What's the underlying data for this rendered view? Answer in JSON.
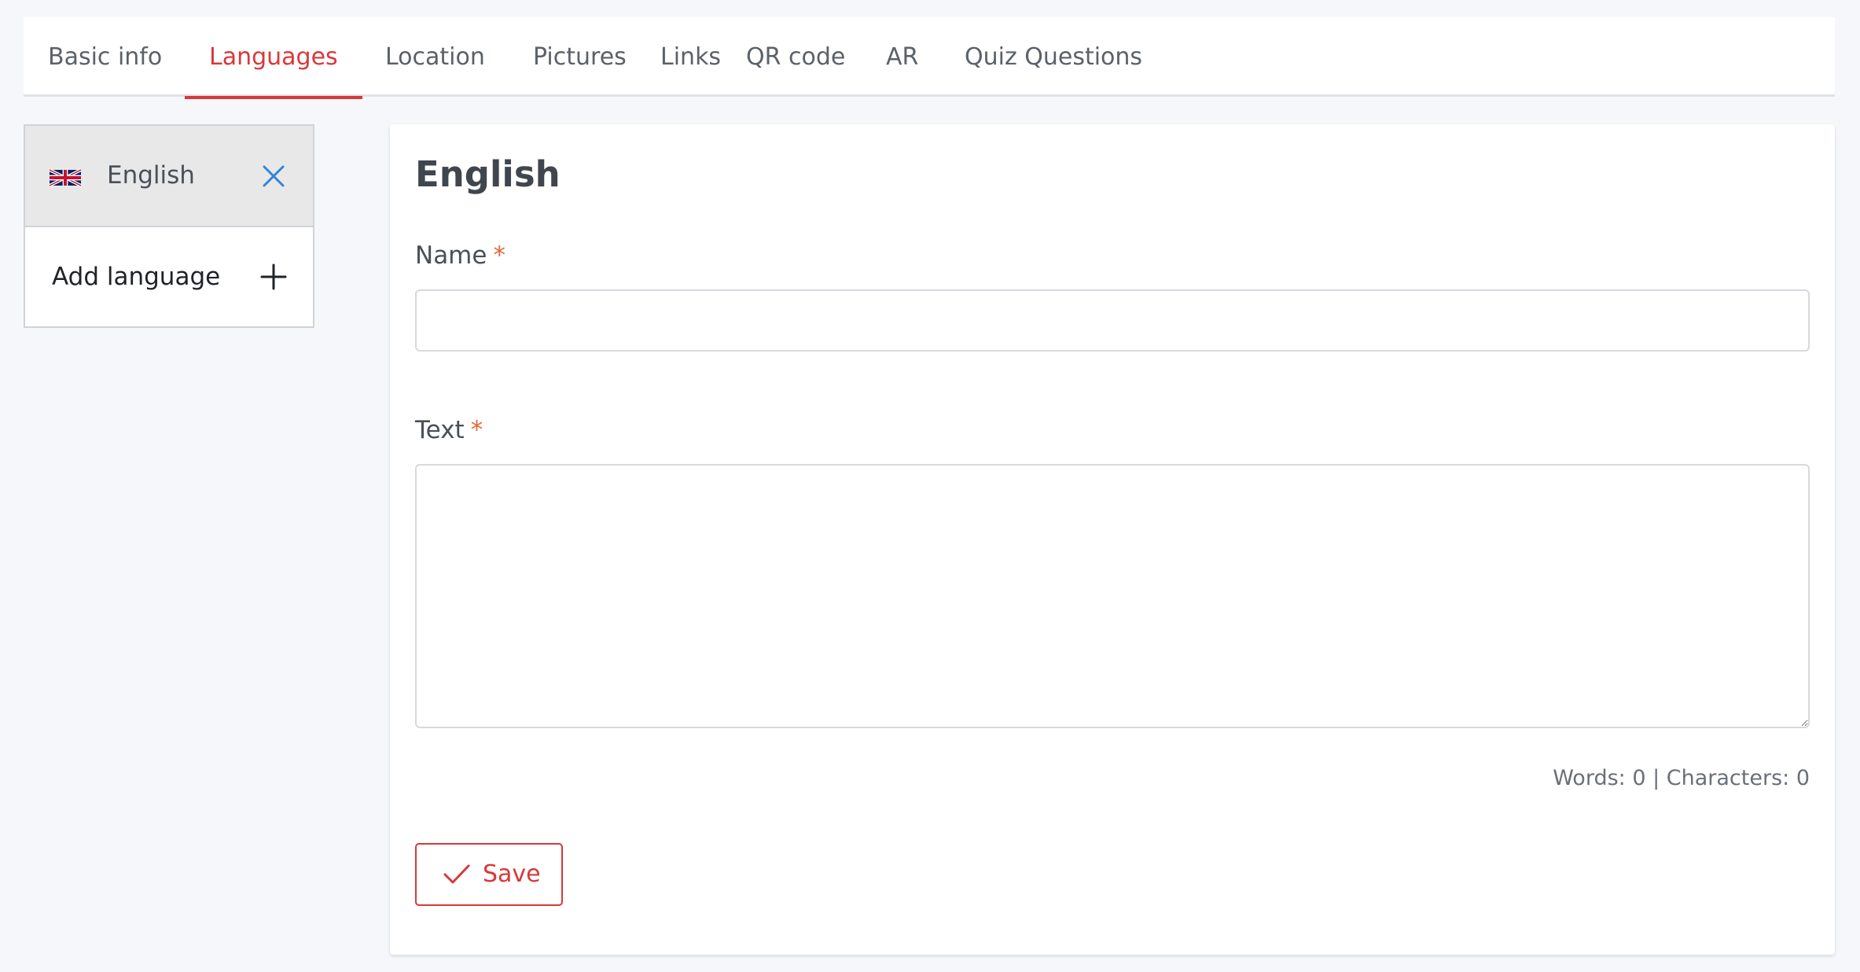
{
  "tabs": [
    {
      "label": "Basic info",
      "active": false
    },
    {
      "label": "Languages",
      "active": true
    },
    {
      "label": "Location",
      "active": false
    },
    {
      "label": "Pictures",
      "active": false
    },
    {
      "label": "Links",
      "active": false
    },
    {
      "label": "QR code",
      "active": false
    },
    {
      "label": "AR",
      "active": false
    },
    {
      "label": "Quiz Questions",
      "active": false
    }
  ],
  "sidebar": {
    "languages": [
      {
        "name": "English",
        "flag_icon": "uk-flag-icon",
        "selected": true
      }
    ],
    "add_label": "Add language"
  },
  "form": {
    "title": "English",
    "name_label": "Name",
    "name_required": "*",
    "name_value": "",
    "text_label": "Text",
    "text_required": "*",
    "text_value": "",
    "counter": "Words: 0 | Characters: 0",
    "save_label": "Save"
  },
  "colors": {
    "accent": "#d9383a",
    "required": "#e2683c",
    "remove_icon": "#2f86d6",
    "background": "#f5f7fa",
    "selected_item": "#e8e8e8"
  }
}
